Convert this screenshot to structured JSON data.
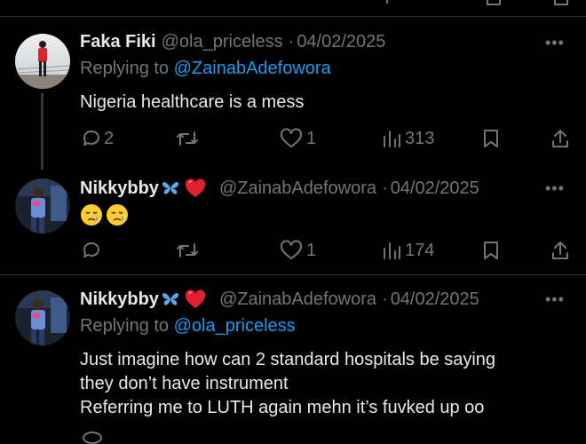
{
  "tweets": [
    {
      "display_name": "Faka Fiki",
      "handle": "@ola_priceless",
      "date": "04/02/2025",
      "reply_prefix": "Replying to",
      "reply_to": "@ZainabAdefowora",
      "lines": [
        "Nigeria healthcare is a mess"
      ],
      "replies": "2",
      "likes": "1",
      "views": "313"
    },
    {
      "display_name": "Nikkybby",
      "handle": "@ZainabAdefowora",
      "date": "04/02/2025",
      "replies": "",
      "likes": "1",
      "views": "174"
    },
    {
      "display_name": "Nikkybby",
      "handle": "@ZainabAdefowora",
      "date": "04/02/2025",
      "reply_prefix": "Replying to",
      "reply_to": "@ola_priceless",
      "lines": [
        "Just imagine how can 2 standard hospitals be saying",
        "they don’t have instrument",
        "Referring me to LUTH again mehn it’s fuvked up oo"
      ]
    }
  ],
  "more_label": "•••",
  "separator": "·",
  "colors": {
    "background": "#000000",
    "text": "#e7e9ea",
    "muted": "#71767b",
    "accent": "#1d9bf0",
    "heart": "#f91880",
    "butterfly": "#5aa9e6"
  },
  "icons": [
    "reply-icon",
    "retweet-icon",
    "like-icon",
    "views-icon",
    "bookmark-icon",
    "share-icon",
    "butterfly-icon",
    "heart-icon",
    "sad-face-emoji"
  ]
}
